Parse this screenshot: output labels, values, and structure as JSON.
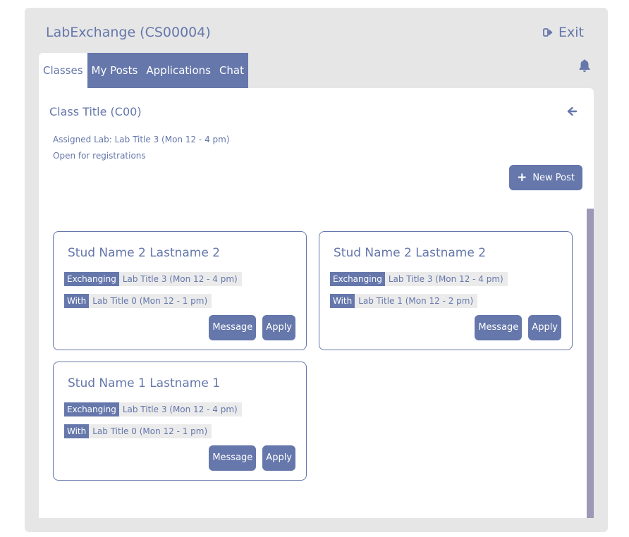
{
  "header": {
    "title": "LabExchange (CS00004)",
    "exit_label": "Exit"
  },
  "tabs": [
    {
      "label": "Classes",
      "active": true
    },
    {
      "label": "My Posts",
      "active": false
    },
    {
      "label": "Applications",
      "active": false
    },
    {
      "label": "Chat",
      "active": false
    }
  ],
  "class": {
    "title": "Class Title (C00)",
    "assigned_lab": "Assigned Lab:  Lab Title 3 (Mon 12 - 4 pm)",
    "status": "Open for registrations"
  },
  "new_post_label": "New Post",
  "posts": [
    {
      "student": "Stud Name 2 Lastname 2",
      "exchanging_label": "Exchanging",
      "exchanging": "Lab Title 3 (Mon 12 - 4 pm)",
      "with_label": "With",
      "with": "Lab Title 0 (Mon 12 - 1 pm)",
      "message_label": "Message",
      "apply_label": "Apply"
    },
    {
      "student": "Stud Name 2 Lastname 2",
      "exchanging_label": "Exchanging",
      "exchanging": "Lab Title 3 (Mon 12 - 4 pm)",
      "with_label": "With",
      "with": "Lab Title 1 (Mon 12 - 2 pm)",
      "message_label": "Message",
      "apply_label": "Apply"
    },
    {
      "student": "Stud Name 1 Lastname 1",
      "exchanging_label": "Exchanging",
      "exchanging": "Lab Title 3 (Mon 12 - 4 pm)",
      "with_label": "With",
      "with": "Lab Title 0 (Mon 12 - 1 pm)",
      "message_label": "Message",
      "apply_label": "Apply"
    }
  ],
  "icons": {
    "exit": "sign-out-icon",
    "bell": "bell-icon",
    "back": "arrow-left-icon",
    "new_post": "plus-icon"
  },
  "colors": {
    "accent": "#6577ab",
    "app_background": "#e6e6e6",
    "scrollbar": "#9b99b6",
    "tag_background": "#ebebeb"
  }
}
